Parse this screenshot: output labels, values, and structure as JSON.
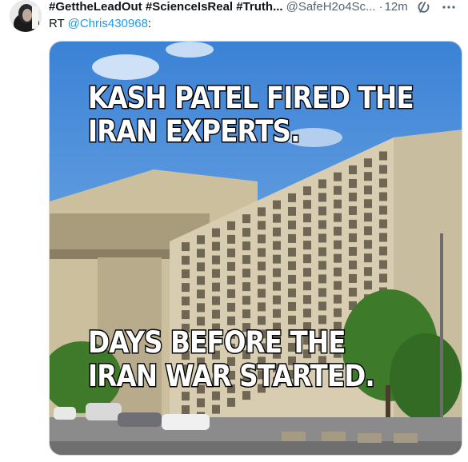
{
  "tweet": {
    "display_name": "#GettheLeadOut #ScienceIsReal #Truth...",
    "handle": "@SafeH2o4Sc...",
    "separator": "·",
    "time": "12m",
    "retweet_prefix": "RT",
    "retweet_mention": "@Chris430968",
    "retweet_suffix": ":"
  },
  "media": {
    "top_line_1": "KASH PATEL FIRED THE",
    "top_line_2": "IRAN EXPERTS.",
    "bottom_line_1": "DAYS BEFORE THE",
    "bottom_line_2": "IRAN WAR STARTED."
  },
  "icons": {
    "grok": "grok-icon",
    "more": "more-options-icon"
  }
}
